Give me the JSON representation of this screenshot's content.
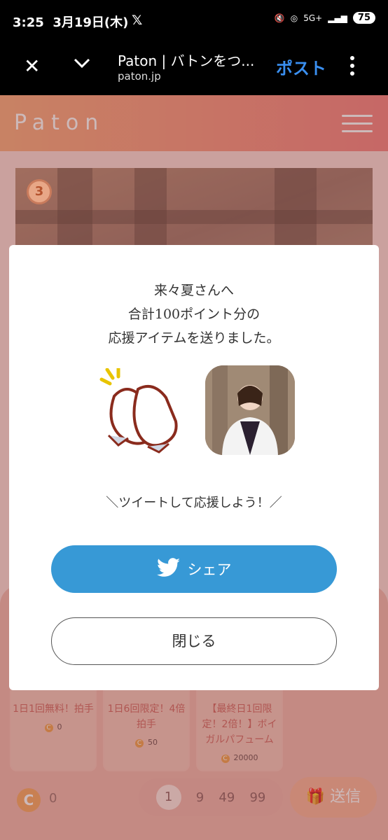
{
  "status_bar": {
    "time": "3:25",
    "date": "3月19日(木)",
    "x_app": "𝕏",
    "network": "5G+",
    "battery": "75"
  },
  "browser": {
    "title": "Paton | バトンをつ...",
    "url": "paton.jp",
    "post_label": "ポスト"
  },
  "site": {
    "logo": "Paton"
  },
  "ranking": {
    "rank": "3"
  },
  "items": [
    {
      "label": "1日1回無料！拍手",
      "points": "0"
    },
    {
      "label": "1日6回限定！4倍拍手",
      "points": "50"
    },
    {
      "label": "【最終日1回限定！2倍！】ボイガルパフューム",
      "points": "20000"
    }
  ],
  "footer": {
    "coin_label": "C",
    "coin_value": "0",
    "quantities": [
      "1",
      "9",
      "49",
      "99"
    ],
    "send_label": "送信"
  },
  "modal": {
    "line1": "来々夏さんへ",
    "line2": "合計100ポイント分の",
    "line3": "応援アイテムを送りました。",
    "tweet_cta": "＼ツイートして応援しよう！／",
    "share_label": "シェア",
    "close_label": "閉じる"
  }
}
